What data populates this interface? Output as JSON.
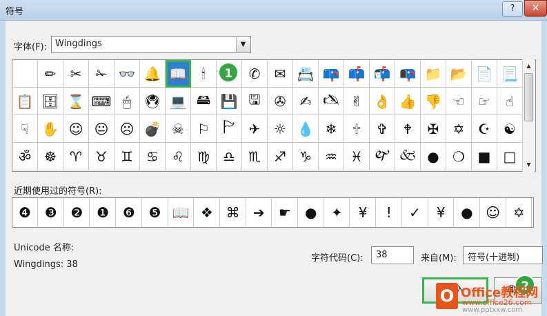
{
  "window": {
    "title": "符号",
    "help_label": "?",
    "close_label": "✕"
  },
  "font": {
    "label": "字体(F):",
    "value": "Wingdings"
  },
  "grid": {
    "rows": [
      [
        "",
        "✏",
        "✂",
        "✁",
        "👓",
        "🔔",
        "📖",
        "🕯",
        "☎",
        "✆",
        "✉",
        "📇",
        "📪",
        "📫",
        "📬",
        "📭",
        "📁",
        "📂",
        "📄",
        "📃"
      ],
      [
        "📋",
        "🗄",
        "⌛",
        "⌨",
        "🖱",
        "🖲",
        "💻",
        "🖴",
        "💾",
        "🖫",
        "✇",
        "✍",
        "🖎",
        "✌",
        "👌",
        "👍",
        "👎",
        "☜",
        "☞",
        "☝"
      ],
      [
        "☟",
        "✋",
        "☺",
        "😐",
        "☹",
        "💣",
        "☠",
        "⚐",
        "🏱",
        "✈",
        "☼",
        "💧",
        "❄",
        "🕆",
        "✞",
        "🕈",
        "✠",
        "✡",
        "☪",
        "☯"
      ],
      [
        "ॐ",
        "☸",
        "♈",
        "♉",
        "♊",
        "♋",
        "♌",
        "♍",
        "♎",
        "♏",
        "♐",
        "♑",
        "♒",
        "♓",
        "🙰",
        "🙵",
        "●",
        "❍",
        "■",
        "□"
      ]
    ]
  },
  "badges": {
    "one": "1",
    "two": "2"
  },
  "recent": {
    "label": "近期使用过的符号(R):",
    "symbols": [
      "❹",
      "❸",
      "❷",
      "❶",
      "❻",
      "❺",
      "📖",
      "❖",
      "⌘",
      "➔",
      "☛",
      "●",
      "✦",
      "¥",
      "!",
      "✓",
      "¥",
      "●",
      "☺",
      "✡"
    ]
  },
  "info": {
    "unicode_label": "Unicode 名称:",
    "font_code": "Wingdings: 38",
    "code_label": "字符代码(C):",
    "code_value": "38",
    "from_label": "来自(M):",
    "from_value": "符号(十进制)"
  },
  "buttons": {
    "insert_label": "插入",
    "cancel_label": "取消"
  },
  "watermark": {
    "logo": "O",
    "line1": "Office教程网",
    "line2": "www.office26.com",
    "line3": "www.pptxxw.com"
  },
  "colors": {
    "selection": "#2f7fd0",
    "highlight_green": "#35b54a",
    "title_bar": "#b7cfe8"
  }
}
